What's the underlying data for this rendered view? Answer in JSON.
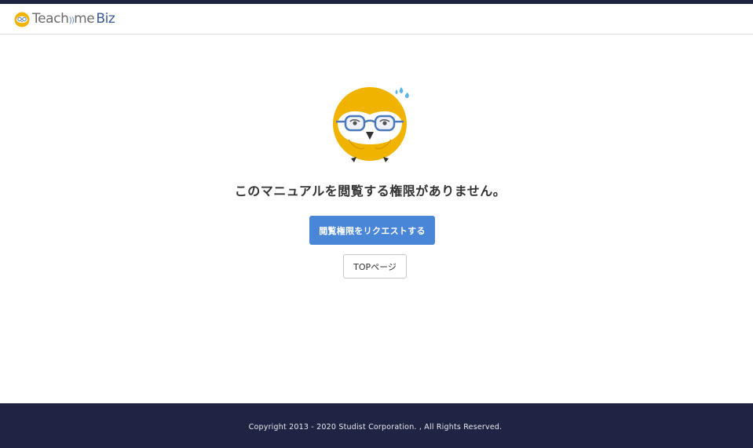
{
  "header": {
    "logo": {
      "icon": "owl-logo-icon",
      "text_teach": "Teach",
      "text_waves": "))",
      "text_me": "me",
      "text_biz": "Biz"
    }
  },
  "main": {
    "illustration": "sweating-owl-with-glasses",
    "message": "このマニュアルを閲覧する権限がありません。",
    "request_button_label": "閲覧権限をリクエストする",
    "top_button_label": "TOPページ"
  },
  "footer": {
    "copyright": "Copyright 2013 - 2020 Studist Corporation. , All Rights Reserved."
  },
  "colors": {
    "navy": "#1f2444",
    "primary_button": "#4a86d8",
    "owl_yellow": "#f0b400",
    "glasses_blue": "#4a78b8"
  }
}
